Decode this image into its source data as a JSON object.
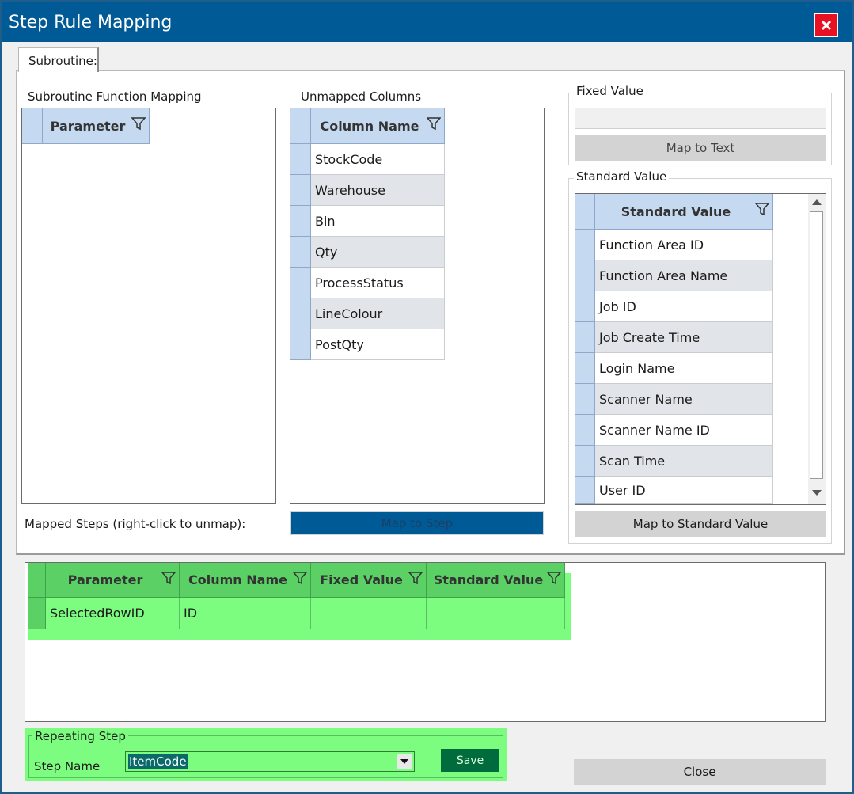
{
  "window": {
    "title": "Step Rule Mapping",
    "close_icon": "close-icon"
  },
  "tab": {
    "label": "Subroutine:"
  },
  "subroutine_mapping": {
    "label": "Subroutine Function Mapping",
    "header": "Parameter"
  },
  "unmapped": {
    "label": "Unmapped Columns",
    "header": "Column Name",
    "rows": [
      "StockCode",
      "Warehouse",
      "Bin",
      "Qty",
      "ProcessStatus",
      "LineColour",
      "PostQty"
    ]
  },
  "fixed_value": {
    "label": "Fixed Value",
    "input_value": "",
    "button": "Map to Text"
  },
  "standard_value": {
    "label": "Standard Value",
    "header": "Standard Value",
    "rows": [
      "Function Area ID",
      "Function Area Name",
      "Job ID",
      "Job Create Time",
      "Login Name",
      "Scanner Name",
      "Scanner Name ID",
      "Scan Time",
      "User ID"
    ],
    "button": "Map to Standard Value"
  },
  "mapped_steps": {
    "label": "Mapped Steps (right-click to unmap):",
    "map_button": "Map to Step",
    "headers": [
      "Parameter",
      "Column Name",
      "Fixed Value",
      "Standard Value"
    ],
    "rows": [
      [
        "SelectedRowID",
        "ID",
        "",
        ""
      ]
    ]
  },
  "repeating": {
    "label": "Repeating Step",
    "step_name_label": "Step Name",
    "step_name_value": "ItemCode",
    "save": "Save"
  },
  "close_button": "Close",
  "colors": {
    "title_bar": "#005a96",
    "header": "#c5d9f1",
    "highlight": "#7dfd80",
    "save": "#006b3c"
  }
}
